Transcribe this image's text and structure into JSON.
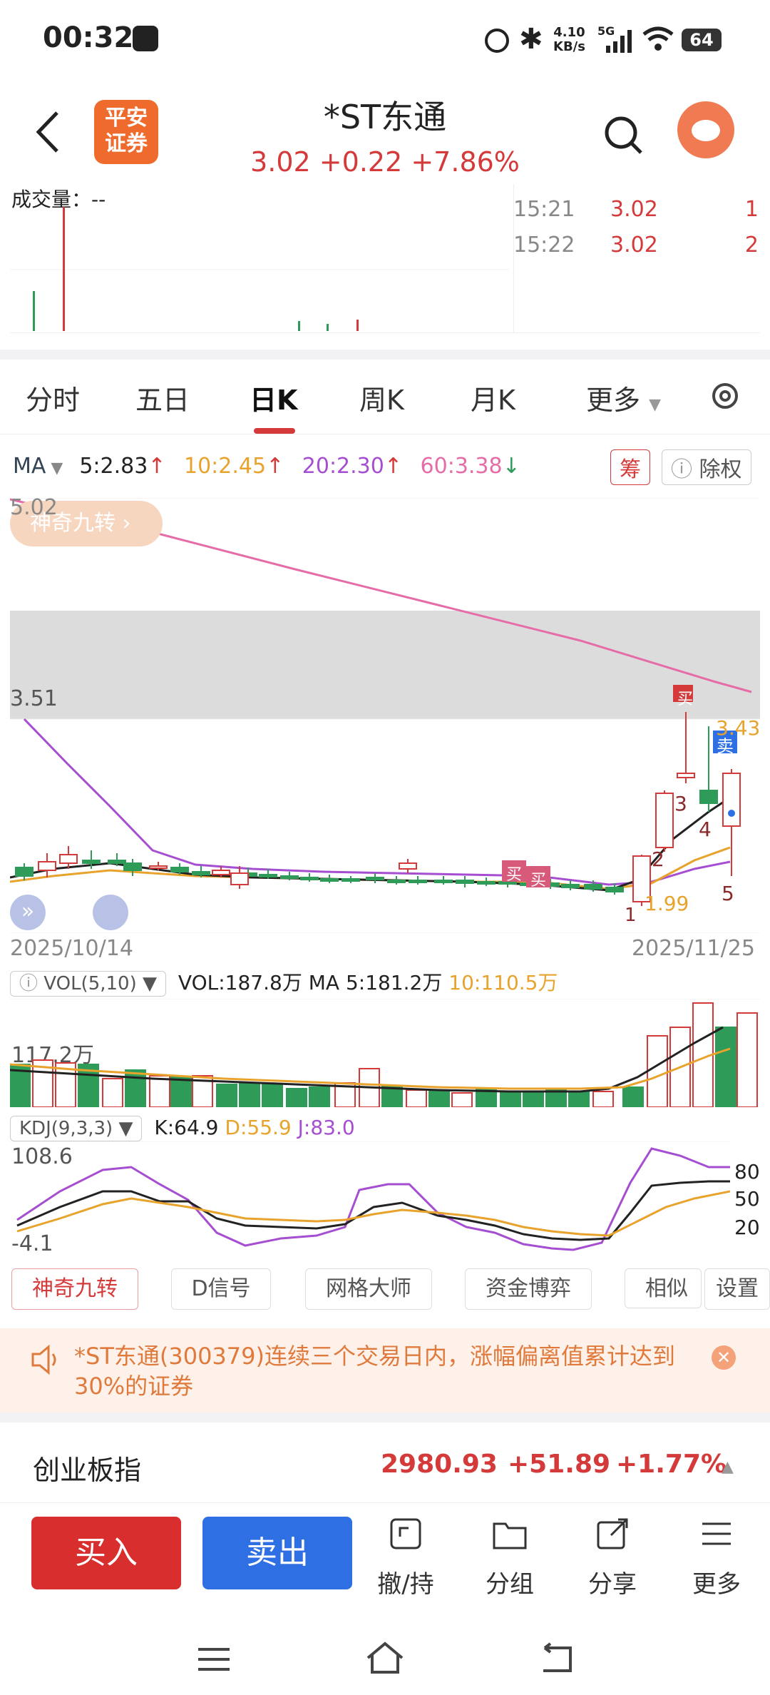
{
  "status_bar": {
    "time": "00:32",
    "net_speed_top": "4.10",
    "net_speed_bottom": "KB/s",
    "network": "5G",
    "battery": "64"
  },
  "header": {
    "broker_logo_line1": "平安",
    "broker_logo_line2": "证券",
    "stock_name": "*ST东通",
    "price": "3.02",
    "change": "+0.22",
    "change_pct": "+7.86%"
  },
  "intraday": {
    "volume_label": "成交量：--",
    "ticks": [
      {
        "time": "15:21",
        "price": "3.02",
        "vol": "1"
      },
      {
        "time": "15:22",
        "price": "3.02",
        "vol": "2"
      }
    ]
  },
  "tabs": [
    "分时",
    "五日",
    "日K",
    "周K",
    "月K",
    "更多"
  ],
  "ma": {
    "label": "MA",
    "ma5": "5:2.83",
    "ma10": "10:2.45",
    "ma20": "20:2.30",
    "ma60": "60:3.38",
    "chip_btn": "筹",
    "adjust_btn": "除权"
  },
  "kline": {
    "badge": "神奇九转",
    "y_top": "5.02",
    "y_mid": "3.51",
    "max_label": "3.43",
    "min_label": "1.99",
    "date_start": "2025/10/14",
    "date_end": "2025/11/25",
    "buy_marker": "买",
    "sell_marker": "卖",
    "nine_turn": [
      "1",
      "2",
      "3",
      "4",
      "5"
    ]
  },
  "vol": {
    "label": "VOL(5,10)",
    "vol": "VOL:187.8万",
    "ma5": "MA 5:181.2万",
    "ma10": "10:110.5万",
    "max": "117.2万"
  },
  "kdj": {
    "label": "KDJ(9,3,3)",
    "k": "K:64.9",
    "d": "D:55.9",
    "j": "J:83.0",
    "top": "108.6",
    "bottom": "-4.1",
    "lvl80": "80",
    "lvl50": "50",
    "lvl20": "20"
  },
  "tools": [
    "神奇九转",
    "D信号",
    "网格大师",
    "资金博弈",
    "相似K",
    "设置"
  ],
  "notice": {
    "text": "*ST东通(300379)连续三个交易日内，涨幅偏离值累计达到30%的证券"
  },
  "index_row": {
    "name": "创业板指",
    "value": "2980.93",
    "change": "+51.89",
    "pct": "+1.77%"
  },
  "actions": {
    "buy": "买入",
    "sell": "卖出",
    "withdraw": "撤/持",
    "group": "分组",
    "share": "分享",
    "more": "更多"
  },
  "colors": {
    "up": "#d43a3a",
    "down": "#2e9b58",
    "ma5": "#222222",
    "ma10": "#e8a32c",
    "ma20": "#a64ed1",
    "ma60": "#e56ca6"
  }
}
